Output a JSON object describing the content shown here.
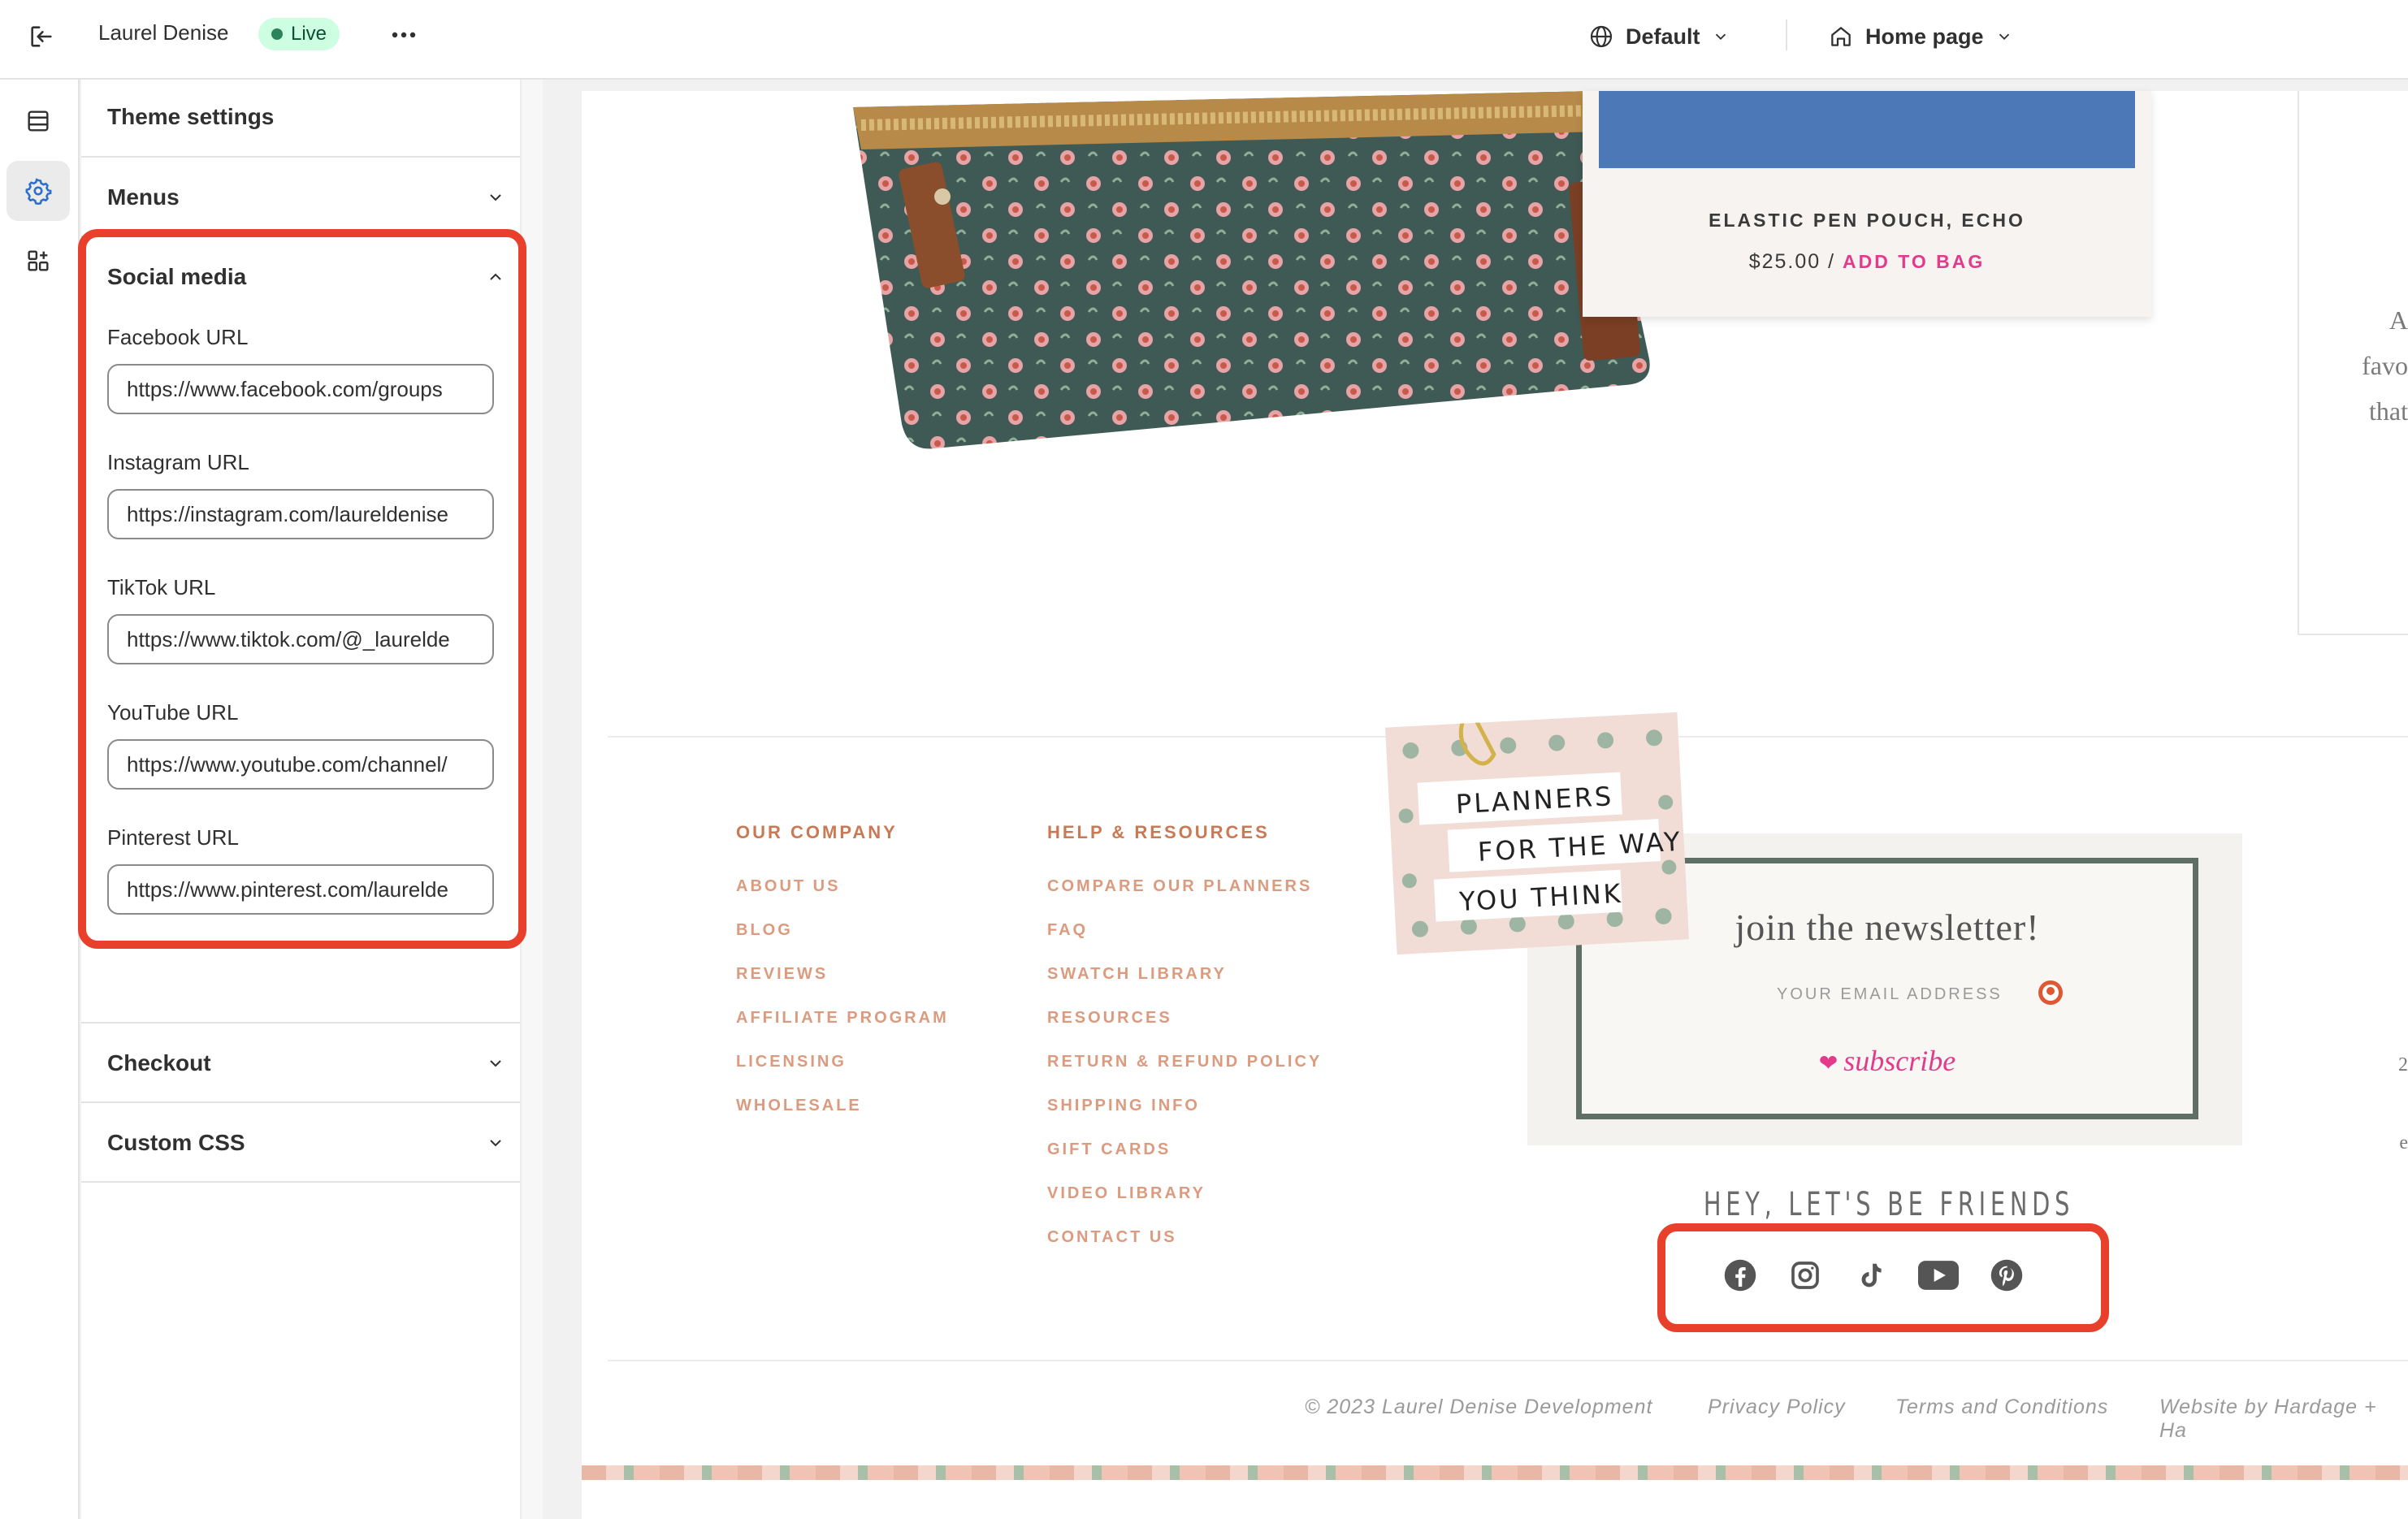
{
  "topbar": {
    "store_name": "Laurel Denise",
    "status": "Live",
    "theme_selector": "Default",
    "page_selector": "Home page"
  },
  "panel": {
    "title": "Theme settings",
    "sections": {
      "menus": "Menus",
      "social": "Social media",
      "checkout": "Checkout",
      "custom_css": "Custom CSS"
    },
    "social_fields": [
      {
        "label": "Facebook URL",
        "value": "https://www.facebook.com/groups"
      },
      {
        "label": "Instagram URL",
        "value": "https://instagram.com/laureldenise"
      },
      {
        "label": "TikTok URL",
        "value": "https://www.tiktok.com/@_laurelde"
      },
      {
        "label": "YouTube URL",
        "value": "https://www.youtube.com/channel/"
      },
      {
        "label": "Pinterest URL",
        "value": "https://www.pinterest.com/laurelde"
      }
    ]
  },
  "preview": {
    "product_card": {
      "name": "ELASTIC PEN POUCH, ECHO",
      "price": "$25.00 / ",
      "cta": "ADD TO BAG"
    },
    "right_text": [
      "A",
      "favo",
      "that",
      "2",
      "e"
    ],
    "footer_columns": [
      {
        "heading": "OUR COMPANY",
        "links": [
          "ABOUT US",
          "BLOG",
          "REVIEWS",
          "AFFILIATE PROGRAM",
          "LICENSING",
          "WHOLESALE"
        ]
      },
      {
        "heading": "HELP & RESOURCES",
        "links": [
          "COMPARE OUR PLANNERS",
          "FAQ",
          "SWATCH LIBRARY",
          "RESOURCES",
          "RETURN & REFUND POLICY",
          "SHIPPING INFO",
          "GIFT CARDS",
          "VIDEO LIBRARY",
          "CONTACT US"
        ]
      }
    ],
    "note_lines": [
      "PLANNERS",
      "FOR THE WAY",
      "YOU THINK"
    ],
    "newsletter": {
      "title": "join the newsletter!",
      "email_placeholder": "YOUR EMAIL ADDRESS",
      "subscribe": "subscribe"
    },
    "friends_heading": "HEY, LET'S BE FRIENDS",
    "social_icons": [
      "facebook-icon",
      "instagram-icon",
      "tiktok-icon",
      "youtube-icon",
      "pinterest-icon"
    ],
    "footer_bottom": {
      "copyright": "© 2023 Laurel Denise Development",
      "privacy": "Privacy Policy",
      "terms": "Terms and Conditions",
      "credit": "Website by Hardage + Ha"
    }
  },
  "colors": {
    "highlight": "#e8402a",
    "link_accent": "#e43a8b",
    "footer_link": "#dc9a7e",
    "newsletter_border": "#5f6f66"
  }
}
